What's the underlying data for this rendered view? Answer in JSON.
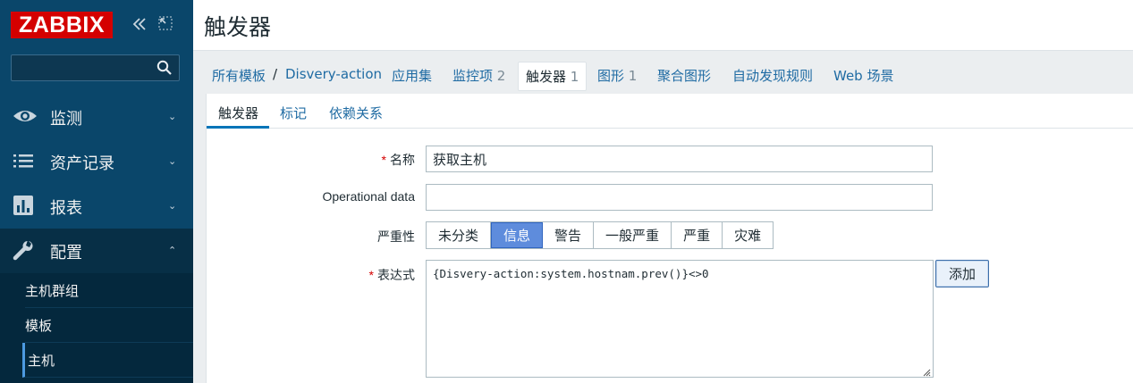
{
  "sidebar": {
    "logo": "ZABBIX",
    "search": {
      "value": "",
      "placeholder": ""
    },
    "menu": [
      {
        "label": "监测",
        "icon": "eye-icon",
        "chevron": "⌄"
      },
      {
        "label": "资产记录",
        "icon": "list-icon",
        "chevron": "⌄"
      },
      {
        "label": "报表",
        "icon": "bar-chart-icon",
        "chevron": "⌄"
      },
      {
        "label": "配置",
        "icon": "wrench-icon",
        "chevron": "⌃"
      }
    ],
    "submenu": [
      {
        "label": "主机群组"
      },
      {
        "label": "模板"
      },
      {
        "label": "主机"
      }
    ]
  },
  "header": {
    "title": "触发器"
  },
  "breadcrumbs": {
    "all_templates": "所有模板",
    "separator": "/",
    "template": "Disvery-action",
    "applications": "应用集",
    "items": "监控项",
    "items_count": "2",
    "triggers": "触发器",
    "triggers_count": "1",
    "graphs": "图形",
    "graphs_count": "1",
    "screens": "聚合图形",
    "discovery": "自动发现规则",
    "web": "Web 场景"
  },
  "tabs": [
    {
      "label": "触发器"
    },
    {
      "label": "标记"
    },
    {
      "label": "依赖关系"
    }
  ],
  "form": {
    "name_label": "名称",
    "name_value": "获取主机",
    "opdata_label": "Operational data",
    "opdata_value": "",
    "severity_label": "严重性",
    "severity_options": [
      "未分类",
      "信息",
      "警告",
      "一般严重",
      "严重",
      "灾难"
    ],
    "severity_selected": "信息",
    "expression_label": "表达式",
    "expression_value": "{Disvery-action:system.hostnam.prev()}<>0",
    "add_button": "添加",
    "required_mark": "*"
  },
  "colors": {
    "sidebar_bg": "#0a466a",
    "logo_bg": "#d40000",
    "link": "#1f6ba3",
    "severity_selected": "#5e8cdc",
    "required": "#d40000"
  }
}
